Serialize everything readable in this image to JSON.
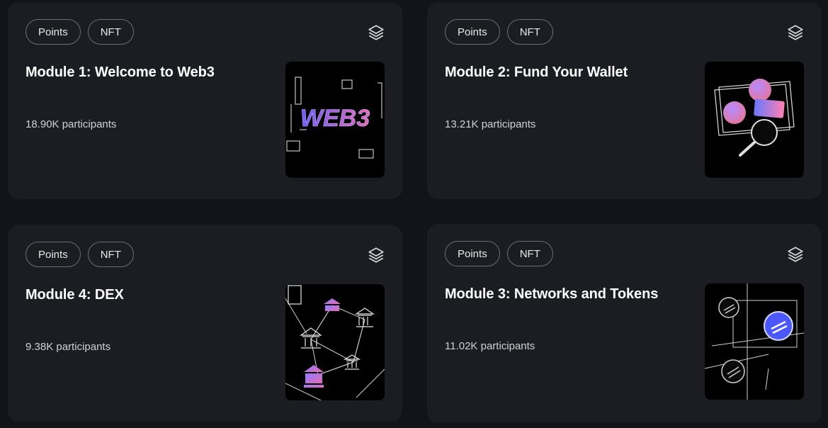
{
  "cards": [
    {
      "tags": [
        "Points",
        "NFT"
      ],
      "title": "Module 1: Welcome to Web3",
      "participants": "18.90K participants",
      "image_text": "WEB3"
    },
    {
      "tags": [
        "Points",
        "NFT"
      ],
      "title": "Module 2: Fund Your Wallet",
      "participants": "13.21K participants"
    },
    {
      "tags": [
        "Points",
        "NFT"
      ],
      "title": "Module 4: DEX",
      "participants": "9.38K participants"
    },
    {
      "tags": [
        "Points",
        "NFT"
      ],
      "title": "Module 3: Networks and Tokens",
      "participants": "11.02K participants"
    }
  ],
  "colors": {
    "page_bg": "#131419",
    "card_bg": "#1c1d23",
    "tag_border": "#6d6e75",
    "accent_purple": "#8a6bff",
    "accent_pink": "#e66bb4"
  },
  "icons": {
    "layers": "layers-icon"
  }
}
